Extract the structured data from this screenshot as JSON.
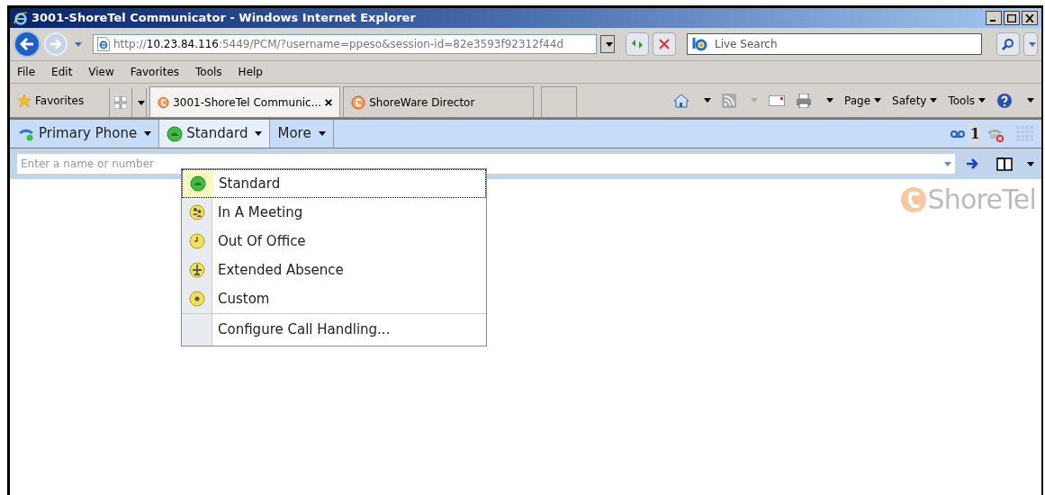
{
  "window": {
    "title": "3001-ShoreTel Communicator - Windows Internet Explorer"
  },
  "address": {
    "scheme": "http://",
    "host": "10.23.84.116",
    "rest": ":5449/PCM/?username=ppeso&session-id=82e3593f92312f44d"
  },
  "search": {
    "placeholder": "Live Search"
  },
  "menu_bar": [
    "File",
    "Edit",
    "View",
    "Favorites",
    "Tools",
    "Help"
  ],
  "favorites": {
    "label": "Favorites"
  },
  "tabs": [
    {
      "label": "3001-ShoreTel Communic...",
      "selected": true
    },
    {
      "label": "ShoreWare Director",
      "selected": false
    }
  ],
  "command_bar": [
    "Page",
    "Safety",
    "Tools"
  ],
  "app_toolbar": {
    "buttons": [
      {
        "label": "Primary Phone",
        "selected": false
      },
      {
        "label": "Standard",
        "selected": true
      },
      {
        "label": "More",
        "selected": false
      }
    ],
    "voicemail_count": "1"
  },
  "dial_field": {
    "placeholder": "Enter a name or number"
  },
  "status_menu": [
    {
      "label": "Standard",
      "kind": "standard",
      "selected": true
    },
    {
      "label": "In A Meeting",
      "kind": "meeting",
      "selected": false
    },
    {
      "label": "Out Of Office",
      "kind": "office",
      "selected": false
    },
    {
      "label": "Extended Absence",
      "kind": "absence",
      "selected": false
    },
    {
      "label": "Custom",
      "kind": "custom",
      "selected": false
    },
    {
      "label": "Configure Call Handling...",
      "kind": "action",
      "selected": false
    }
  ],
  "logo": {
    "text": "ShoreTel"
  }
}
